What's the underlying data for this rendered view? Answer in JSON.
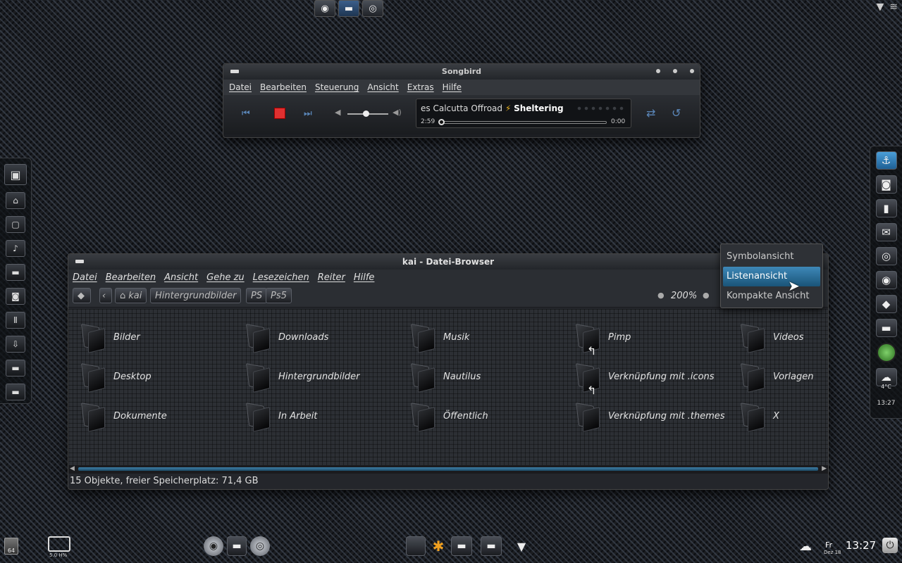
{
  "top_panel": {
    "launchers": [
      {
        "icon": "globe-icon"
      },
      {
        "icon": "folder-icon"
      },
      {
        "icon": "music-player-icon"
      }
    ]
  },
  "songbird": {
    "title": "Songbird",
    "menu": [
      "Datei",
      "Bearbeiten",
      "Steuerung",
      "Ansicht",
      "Extras",
      "Hilfe"
    ],
    "track_prefix": "es",
    "artist": "Calcutta Offroad",
    "track": "Sheltering",
    "time_elapsed": "2:59",
    "time_remaining": "0:00",
    "volume_level": 0.45,
    "progress": 0.0,
    "colors": {
      "stop": "#e03030",
      "controls": "#5a86b8"
    }
  },
  "file_browser": {
    "title": "kai - Datei-Browser",
    "menu": [
      "Datei",
      "Bearbeiten",
      "Ansicht",
      "Gehe zu",
      "Lesezeichen",
      "Reiter",
      "Hilfe"
    ],
    "path": [
      "kai",
      "Hintergrundbilder",
      "PS",
      "Ps5"
    ],
    "zoom": "200%",
    "files": [
      {
        "name": "Bilder"
      },
      {
        "name": "Downloads"
      },
      {
        "name": "Musik"
      },
      {
        "name": "Pimp"
      },
      {
        "name": "Videos"
      },
      {
        "name": "Desktop"
      },
      {
        "name": "Hintergrundbilder"
      },
      {
        "name": "Nautilus"
      },
      {
        "name": "Verknüpfung mit .icons",
        "link": true
      },
      {
        "name": "Vorlagen"
      },
      {
        "name": "Dokumente"
      },
      {
        "name": "In Arbeit"
      },
      {
        "name": "Öffentlich"
      },
      {
        "name": "Verknüpfung mit .themes",
        "link": true
      },
      {
        "name": "X"
      }
    ],
    "status": "15 Objekte, freier Speicherplatz: 71,4 GB"
  },
  "view_menu": {
    "items": [
      "Symbolansicht",
      "Listenansicht",
      "Kompakte Ansicht"
    ],
    "selected": "Listenansicht"
  },
  "right_dock": {
    "weather": "4°C",
    "clock": "13:27"
  },
  "bottom_panel": {
    "trash_label": "64",
    "monitor_label": "5.0 H%",
    "day": "Fr",
    "date": "Dez 18",
    "clock": "13:27"
  }
}
